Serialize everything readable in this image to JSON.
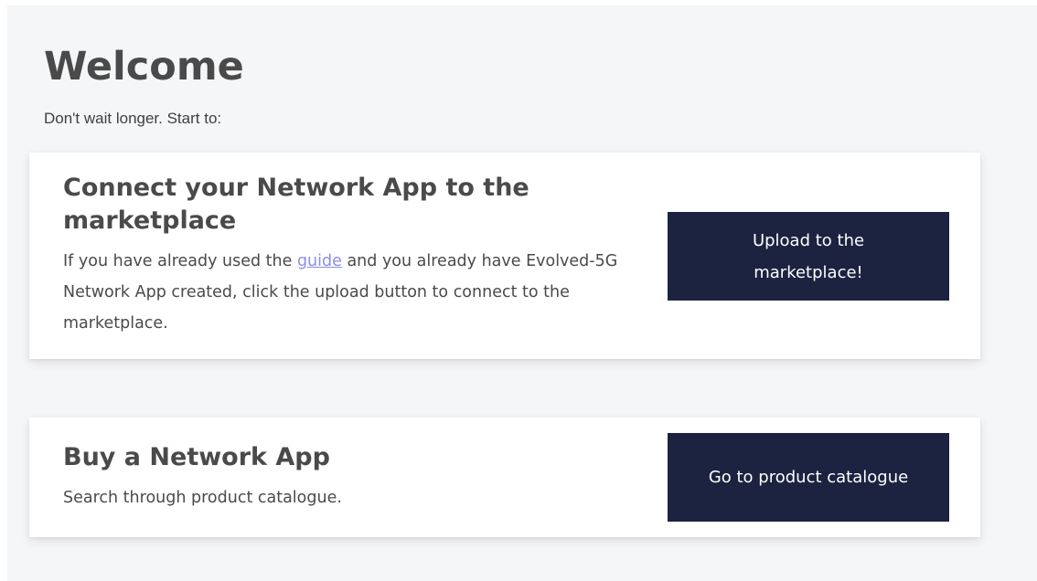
{
  "welcome": {
    "title": "Welcome",
    "subtitle": "Don't wait longer. Start to:"
  },
  "cards": [
    {
      "title": "Connect your Network App to the marketplace",
      "text_before_link": "If you have already used the ",
      "link_label": "guide",
      "text_after_link": " and you already have Evolved-5G Network App created, click the upload button to connect to the marketplace.",
      "button_label": "Upload to the marketplace!"
    },
    {
      "title": "Buy a Network App",
      "text": "Search through product catalogue.",
      "button_label": "Go to product catalogue"
    }
  ],
  "colors": {
    "background": "#f5f6f8",
    "button": "#1b2340",
    "link": "#8a8fe8",
    "text": "#4a4a4a"
  }
}
